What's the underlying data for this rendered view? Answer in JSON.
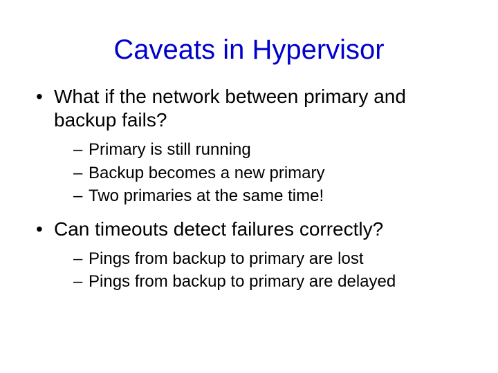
{
  "title": "Caveats in Hypervisor",
  "bullets": [
    {
      "text": "What if the network between primary and backup fails?",
      "sub": [
        "Primary is still running",
        "Backup becomes a new primary",
        "Two primaries at the same time!"
      ]
    },
    {
      "text": "Can timeouts detect failures correctly?",
      "sub": [
        "Pings from backup to primary are lost",
        "Pings from backup to primary are delayed"
      ]
    }
  ]
}
